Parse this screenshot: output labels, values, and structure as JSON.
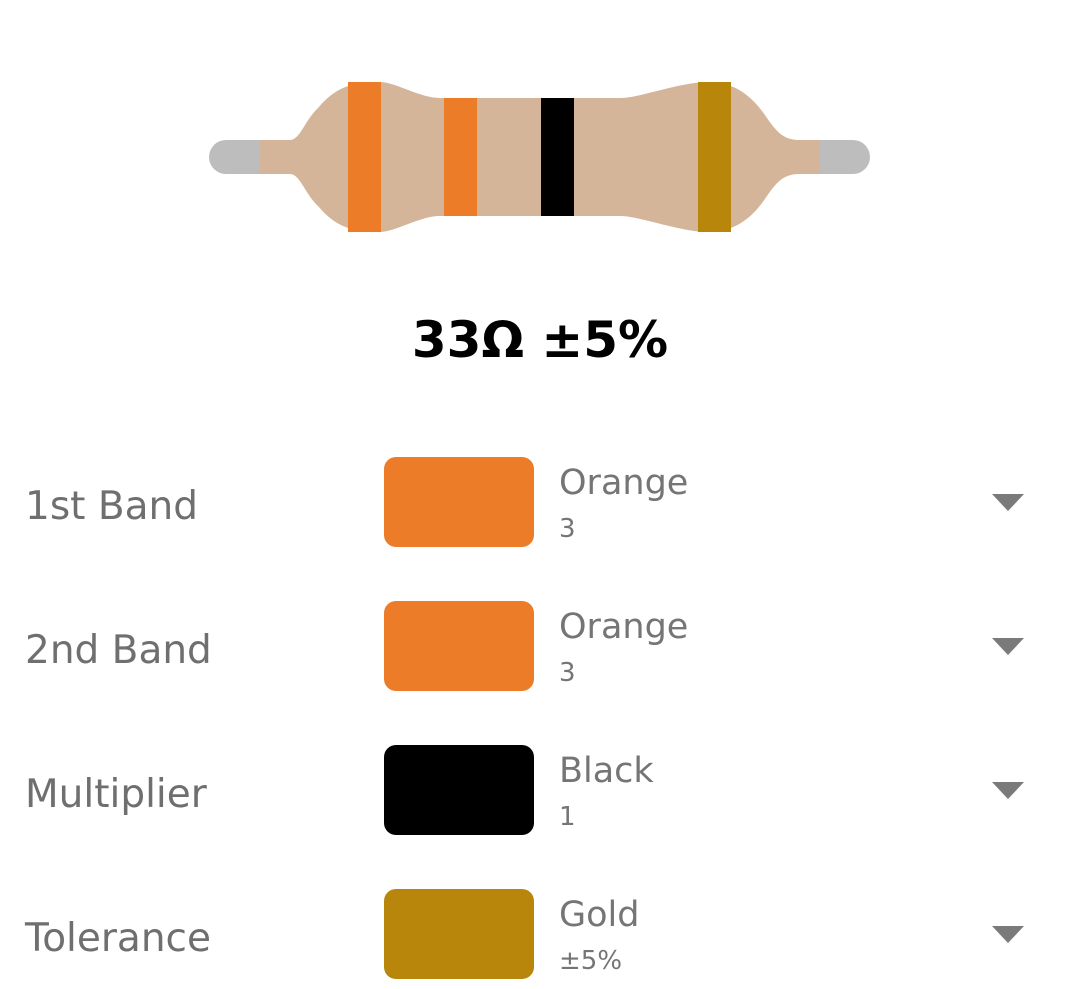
{
  "result": {
    "text": "33Ω ±5%"
  },
  "resistor": {
    "body_color": "#d5b59a",
    "lead_color": "#bdbdbd",
    "band_colors": [
      "#ec7c28",
      "#ec7c28",
      "#000000",
      "#b8860b"
    ]
  },
  "bands": [
    {
      "label": "1st Band",
      "color_name": "Orange",
      "value": "3",
      "color": "#ec7c28"
    },
    {
      "label": "2nd Band",
      "color_name": "Orange",
      "value": "3",
      "color": "#ec7c28"
    },
    {
      "label": "Multiplier",
      "color_name": "Black",
      "value": "1",
      "color": "#000000"
    },
    {
      "label": "Tolerance",
      "color_name": "Gold",
      "value": "±5%",
      "color": "#b8860b"
    }
  ]
}
